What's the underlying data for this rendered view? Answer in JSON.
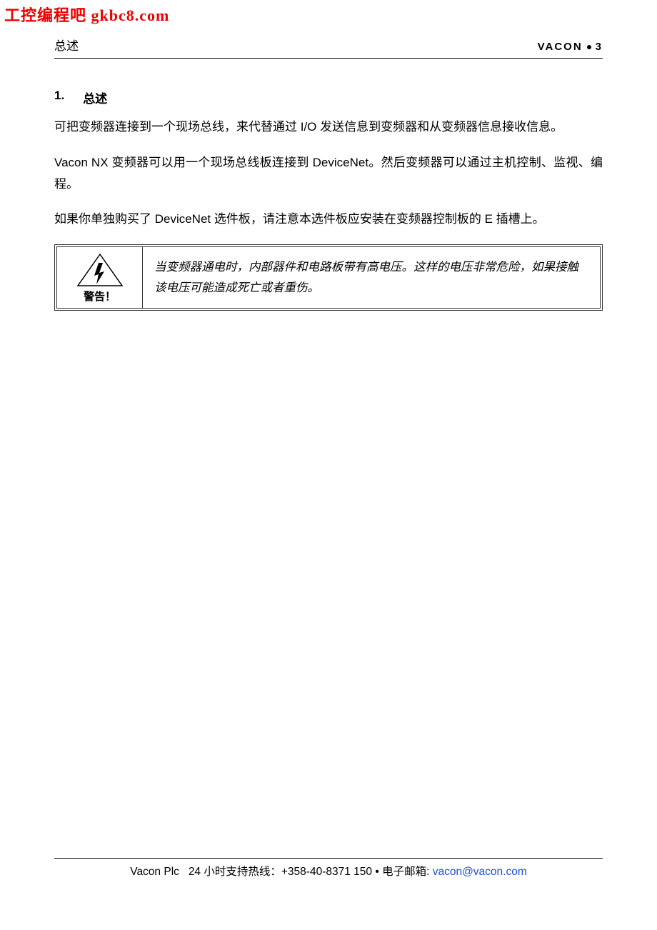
{
  "watermark": "工控编程吧  gkbc8.com",
  "header": {
    "left": "总述",
    "brand": "VACON",
    "page_number": "3"
  },
  "section": {
    "number": "1.",
    "title": "总述"
  },
  "paragraphs": {
    "p1": "可把变频器连接到一个现场总线，来代替通过 I/O 发送信息到变频器和从变频器信息接收信息。",
    "p2": "Vacon NX 变频器可以用一个现场总线板连接到 DeviceNet。然后变频器可以通过主机控制、监视、编程。",
    "p3": "如果你单独购买了 DeviceNet 选件板，请注意本选件板应安装在变频器控制板的 E 插槽上。"
  },
  "warning": {
    "label": "警告！",
    "text": "当变频器通电时，内部器件和电路板带有高电压。这样的电压非常危险，如果接触该电压可能造成死亡或者重伤。"
  },
  "footer": {
    "company": "Vacon Plc",
    "hotline_label": "24 小时支持热线：",
    "hotline_number": "+358-40-8371 150",
    "separator": "•",
    "email_label": "电子邮箱:",
    "email": "vacon@vacon.com"
  }
}
